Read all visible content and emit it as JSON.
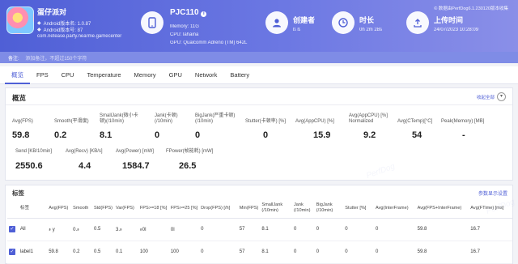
{
  "header": {
    "app_name": "蛋仔派对",
    "android_version_name": "Android版本名: 1.0.87",
    "android_version_code": "Android版本号: 87",
    "package": "com.netease.party.nearme.gamecenter",
    "device": {
      "name": "PJC110",
      "info_icon": "info-icon",
      "memory": "Memory: 11G",
      "cpu": "CPU: lahaina",
      "gpu": "GPU: Qualcomm Adreno (TM) 642L"
    },
    "creator": {
      "label": "创建者",
      "value": "ß ß"
    },
    "duration": {
      "label": "时长",
      "value": "0h 2m 28s"
    },
    "upload": {
      "label": "上传时间",
      "value": "24/07/2023 10:28:09"
    },
    "copyright": "© 数据由PerfDog6.1.230120版本收集"
  },
  "note": {
    "label": "备注:",
    "placeholder": "添加备注，不超过150个字符"
  },
  "tabs": [
    "概览",
    "FPS",
    "CPU",
    "Temperature",
    "Memory",
    "GPU",
    "Network",
    "Battery"
  ],
  "overview": {
    "title": "概览",
    "expand_link": "收起全部",
    "metrics": [
      {
        "label": "Avg(FPS)",
        "value": "59.8"
      },
      {
        "label": "Smooth(平滑度)",
        "value": "0.2"
      },
      {
        "label": "SmallJank(微小卡顿)(/10min)",
        "value": "8.1"
      },
      {
        "label": "Jank(卡顿)(/10min)",
        "value": "0"
      },
      {
        "label": "BigJank(严重卡顿)(/10min)",
        "value": "0"
      },
      {
        "label": "Stutter(卡顿率) [%]",
        "value": "0"
      },
      {
        "label": "Avg(AppCPU) [%]",
        "value": "15.9"
      },
      {
        "label": "Avg(AppCPU) [%] Normalized",
        "value": "9.2"
      },
      {
        "label": "Avg(CTemp)[°C]",
        "value": "54"
      },
      {
        "label": "Peak(Memory) [MB]",
        "value": "-"
      },
      {
        "label": "Send [KB/10min]",
        "value": "2550.6"
      },
      {
        "label": "Avg(Recv) [KB/s]",
        "value": "4.4"
      },
      {
        "label": "Avg(Power) [mW]",
        "value": "1584.7"
      },
      {
        "label": "FPower(帧能耗) [mW]",
        "value": "26.5"
      }
    ]
  },
  "labels_section": {
    "title": "标签",
    "link": "参数显示设置",
    "columns": [
      "标签",
      "Avg(FPS)",
      "Smooth",
      "Std(FPS)",
      "Var(FPS)",
      "FPS>=18 [%]",
      "FPS>=25 [%]",
      "Drop(FPS) [/h]",
      "Min(FPS)",
      "SmallJank (/10min)",
      "Jank (/10min)",
      "BigJank (/10min)",
      "Stutter [%]",
      "Avg(InterFrame)",
      "Avg(FPS+InterFrame)",
      "Avg(FTime) [ms]"
    ],
    "rows": [
      [
        "All",
        "ء y",
        "0.ء",
        "0.5",
        "ء.3",
        "ا0ء",
        "ا0",
        "0",
        "57",
        "8.1",
        "0",
        "0",
        "0",
        "0",
        "59.8",
        "16.7"
      ],
      [
        "label1",
        "59.8",
        "0.2",
        "0.5",
        "0.1",
        "100",
        "100",
        "0",
        "57",
        "8.1",
        "0",
        "0",
        "0",
        "0",
        "59.8",
        "16.7"
      ]
    ]
  },
  "watermark": "PerfDog"
}
